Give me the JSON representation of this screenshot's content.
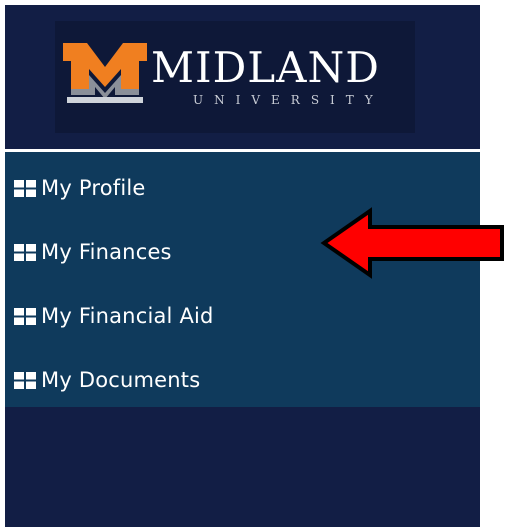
{
  "logo": {
    "wordmark": "MIDLAND",
    "subtitle": "UNIVERSITY"
  },
  "menu": {
    "items": [
      {
        "label": "My Profile",
        "icon": "grid-icon"
      },
      {
        "label": "My Finances",
        "icon": "grid-icon"
      },
      {
        "label": "My Financial Aid",
        "icon": "grid-icon"
      },
      {
        "label": "My Documents",
        "icon": "grid-icon"
      }
    ]
  },
  "colors": {
    "sidebar_bg": "#121e45",
    "menu_bg": "#0f3a5c",
    "logo_orange": "#f07f20",
    "arrow_red": "#ff0000"
  },
  "annotation": {
    "icon": "red-arrow-icon",
    "points_to": "My Finances"
  }
}
